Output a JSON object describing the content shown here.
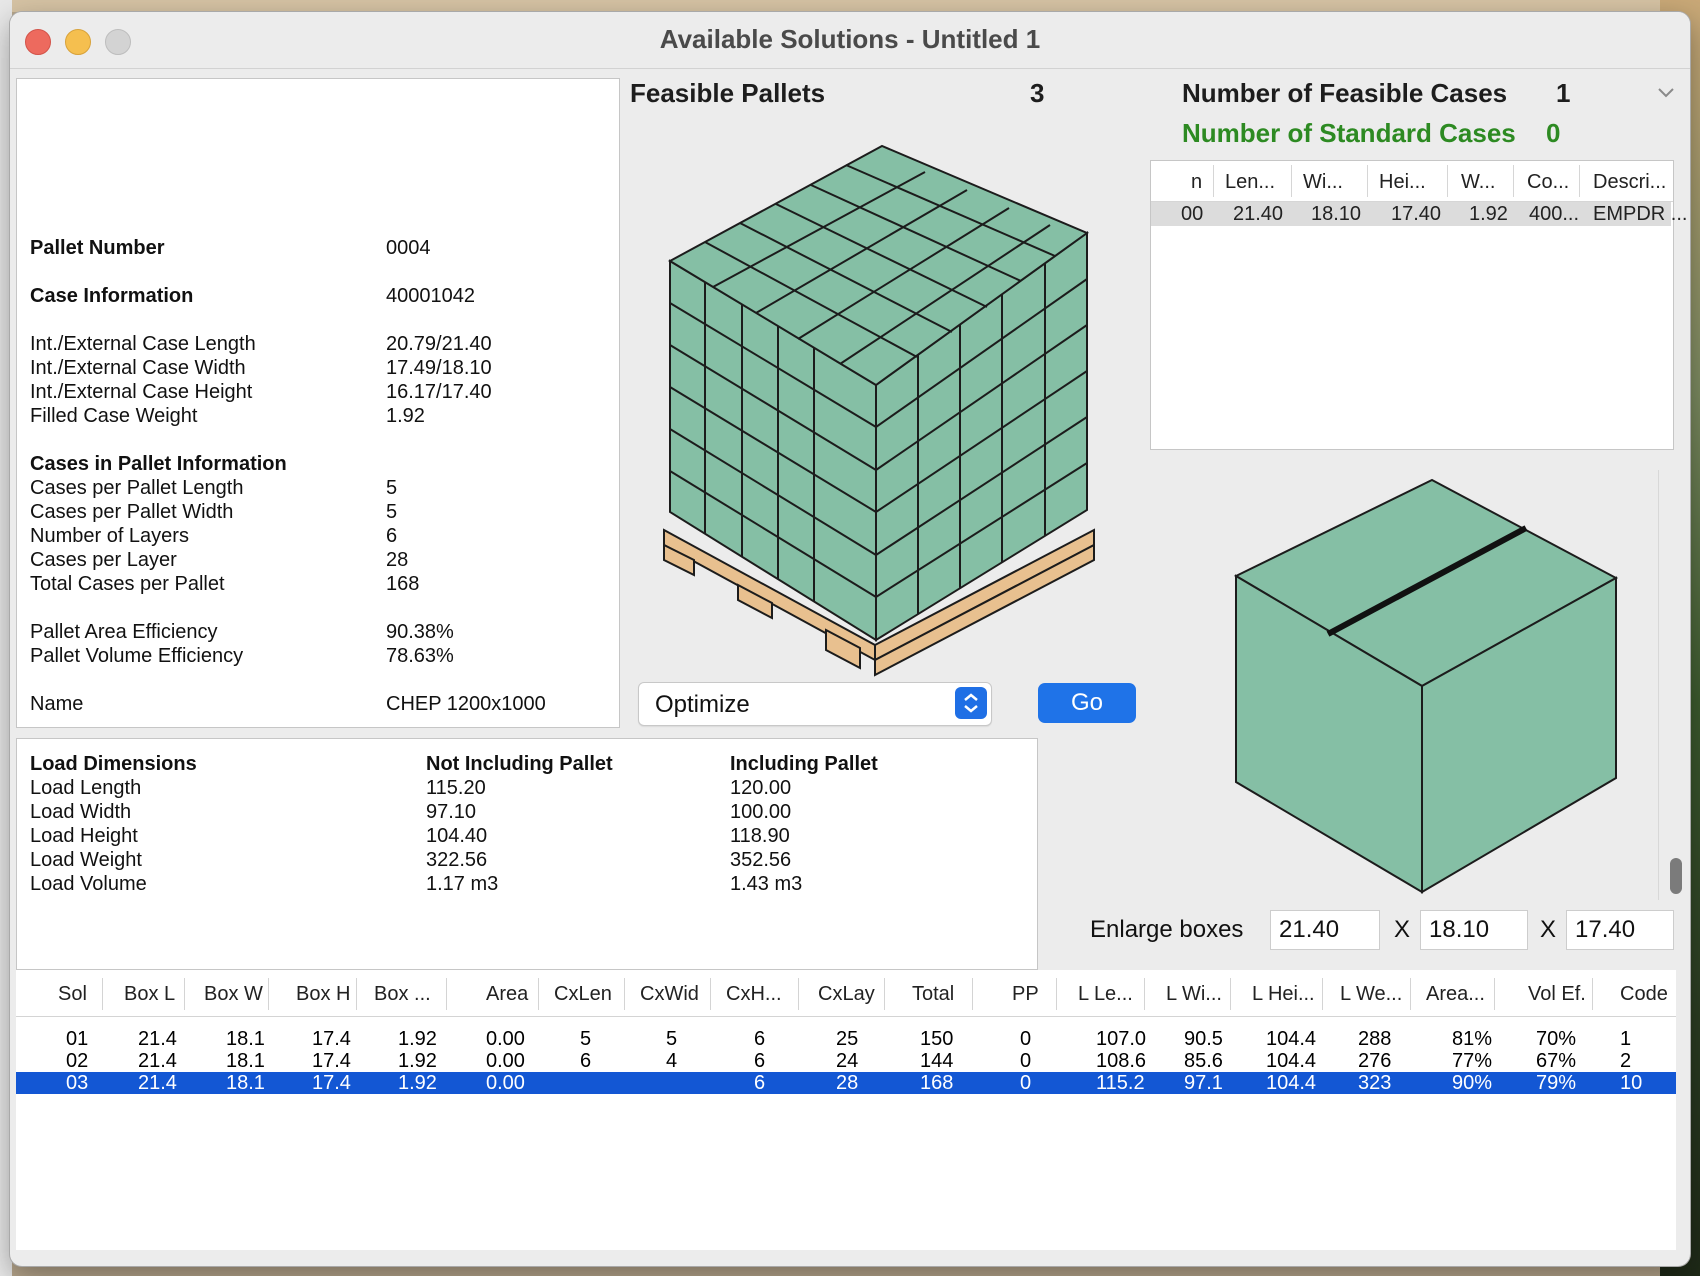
{
  "window": {
    "title": "Available Solutions - Untitled 1"
  },
  "info": {
    "pallet_number_label": "Pallet Number",
    "pallet_number": "0004",
    "case_info_label": "Case Information",
    "case_info": "40001042",
    "rows_case": [
      {
        "label": "Int./External Case Length",
        "value": "20.79/21.40"
      },
      {
        "label": "Int./External Case Width",
        "value": "17.49/18.10"
      },
      {
        "label": "Int./External Case Height",
        "value": "16.17/17.40"
      },
      {
        "label": "Filled Case Weight",
        "value": "1.92"
      }
    ],
    "cases_in_pallet_label": "Cases in Pallet Information",
    "rows_pallet": [
      {
        "label": "Cases per Pallet Length",
        "value": "5"
      },
      {
        "label": "Cases per Pallet Width",
        "value": "5"
      },
      {
        "label": "Number of Layers",
        "value": "6"
      },
      {
        "label": "Cases per Layer",
        "value": "28"
      },
      {
        "label": "Total Cases per Pallet",
        "value": "168"
      }
    ],
    "rows_eff": [
      {
        "label": "Pallet Area Efficiency",
        "value": "90.38%"
      },
      {
        "label": "Pallet Volume Efficiency",
        "value": "78.63%"
      }
    ],
    "name_label": "Name",
    "name": "CHEP 1200x1000"
  },
  "load": {
    "header": [
      "Load Dimensions",
      "Not Including Pallet",
      "Including Pallet"
    ],
    "rows": [
      [
        "Load Length",
        "115.20",
        "120.00"
      ],
      [
        "Load Width",
        "97.10",
        "100.00"
      ],
      [
        "Load Height",
        "104.40",
        "118.90"
      ],
      [
        "Load Weight",
        "322.56",
        "352.56"
      ],
      [
        "Load Volume",
        "1.17 m3",
        "1.43 m3"
      ]
    ]
  },
  "feasible": {
    "label": "Feasible Pallets",
    "count": "3"
  },
  "cases": {
    "feasible_label": "Number of Feasible Cases",
    "feasible_count": "1",
    "standard_label": "Number of Standard Cases",
    "standard_count": "0",
    "colors": {
      "standard": "#2d8a22"
    },
    "table": {
      "columns": [
        "n",
        "Len...",
        "Wi...",
        "Hei...",
        "W...",
        "Co...",
        "Descri..."
      ],
      "rows": [
        [
          "00",
          "21.40",
          "18.10",
          "17.40",
          "1.92",
          "400...",
          "EMPDR ..."
        ]
      ]
    }
  },
  "controls": {
    "mode_select": "Optimize",
    "go_label": "Go",
    "enlarge_label": "Enlarge boxes",
    "x_label": "X",
    "enlarge_values": [
      "21.40",
      "18.10",
      "17.40"
    ]
  },
  "solutions": {
    "columns": [
      "Sol",
      "Box L",
      "Box W",
      "Box H",
      "Box ...",
      "Area",
      "CxLen",
      "CxWid",
      "CxH...",
      "CxLay",
      "Total",
      "PP",
      "L Le...",
      "L Wi...",
      "L Hei...",
      "L We...",
      "Area...",
      "Vol Ef.",
      "Code"
    ],
    "rows": [
      [
        "01",
        "21.4",
        "18.1",
        "17.4",
        "1.92",
        "0.00",
        "5",
        "5",
        "6",
        "25",
        "150",
        "0",
        "107.0",
        "90.5",
        "104.4",
        "288",
        "81%",
        "70%",
        "1"
      ],
      [
        "02",
        "21.4",
        "18.1",
        "17.4",
        "1.92",
        "0.00",
        "6",
        "4",
        "6",
        "24",
        "144",
        "0",
        "108.6",
        "85.6",
        "104.4",
        "276",
        "77%",
        "67%",
        "2"
      ],
      [
        "03",
        "21.4",
        "18.1",
        "17.4",
        "1.92",
        "0.00",
        "",
        "",
        "6",
        "28",
        "168",
        "0",
        "115.2",
        "97.1",
        "104.4",
        "323",
        "90%",
        "79%",
        "10"
      ]
    ],
    "selected_index": 2,
    "colors": {
      "selection": "#1357d4"
    }
  },
  "colors": {
    "box": "#85bfa5",
    "pallet": "#e8c08f",
    "accent": "#1f73e8"
  }
}
